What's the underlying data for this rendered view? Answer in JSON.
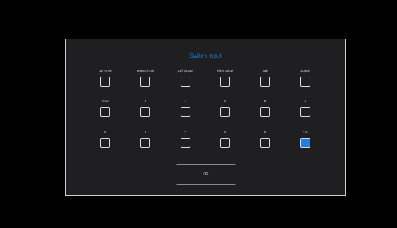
{
  "dialog": {
    "title": "Switch input",
    "ok_label": "OK"
  },
  "keys": [
    {
      "label": "Up Arrow",
      "checked": false
    },
    {
      "label": "Down Arrow",
      "checked": false
    },
    {
      "label": "Left Arrow",
      "checked": false
    },
    {
      "label": "Right Arrow",
      "checked": false
    },
    {
      "label": "Tab",
      "checked": false
    },
    {
      "label": "Space",
      "checked": false
    },
    {
      "label": "Enter",
      "checked": false
    },
    {
      "label": "0",
      "checked": false
    },
    {
      "label": "1",
      "checked": false
    },
    {
      "label": "2",
      "checked": false
    },
    {
      "label": "3",
      "checked": false
    },
    {
      "label": "4",
      "checked": false
    },
    {
      "label": "5",
      "checked": false
    },
    {
      "label": "6",
      "checked": false
    },
    {
      "label": "7",
      "checked": false
    },
    {
      "label": "8",
      "checked": false
    },
    {
      "label": "9",
      "checked": false
    },
    {
      "label": "F12",
      "checked": true
    }
  ],
  "colors": {
    "accent": "#1f7fdc",
    "dialog_bg": "#1f1f21",
    "screen_bg": "#000000"
  }
}
